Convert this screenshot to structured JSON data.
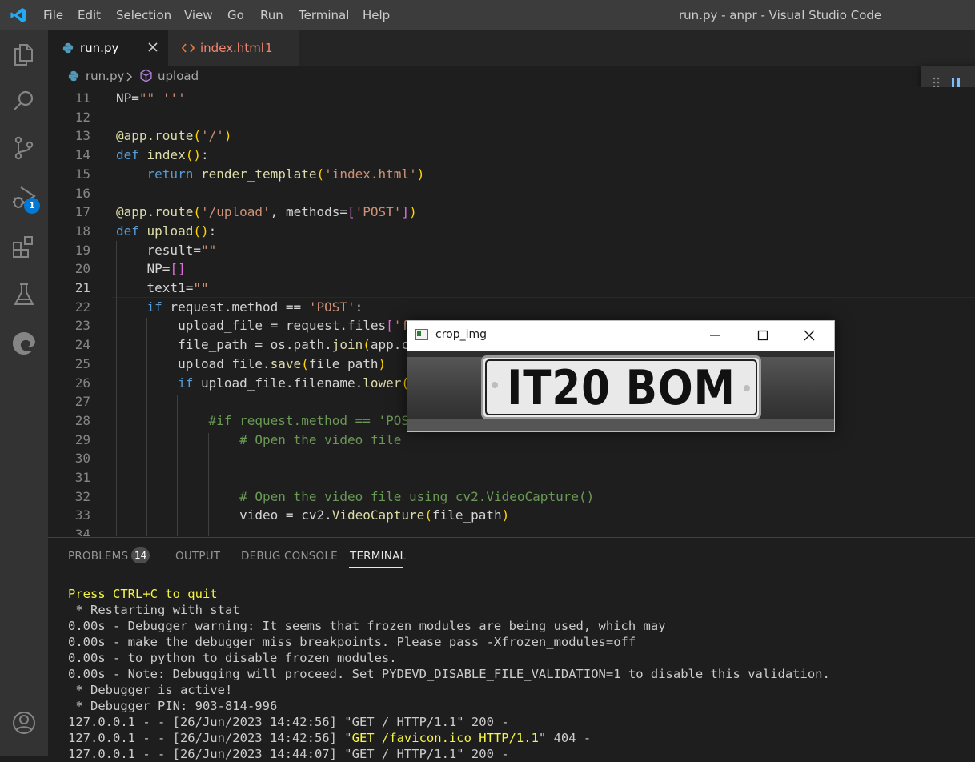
{
  "menubar": {
    "items": [
      "File",
      "Edit",
      "Selection",
      "View",
      "Go",
      "Run",
      "Terminal",
      "Help"
    ],
    "window_title": "run.py - anpr - Visual Studio Code"
  },
  "activity_bar": {
    "icons": [
      "explorer-icon",
      "search-icon",
      "source-control-icon",
      "run-debug-icon",
      "extensions-icon",
      "testing-icon",
      "edge-devtools-icon",
      "account-icon"
    ],
    "debug_badge": "1"
  },
  "tabs": [
    {
      "label": "run.py",
      "active": true
    },
    {
      "label": "index.html",
      "problems": "1",
      "active": false
    }
  ],
  "breadcrumb": {
    "file": "run.py",
    "symbol": "upload"
  },
  "editor": {
    "lines": [
      {
        "n": "11",
        "code": "NP=\"\" '''"
      },
      {
        "n": "12",
        "code": ""
      },
      {
        "n": "13",
        "code": "@app.route('/')"
      },
      {
        "n": "14",
        "code": "def index():"
      },
      {
        "n": "15",
        "code": "    return render_template('index.html')"
      },
      {
        "n": "16",
        "code": ""
      },
      {
        "n": "17",
        "code": "@app.route('/upload', methods=['POST'])"
      },
      {
        "n": "18",
        "code": "def upload():"
      },
      {
        "n": "19",
        "code": "    result=\"\""
      },
      {
        "n": "20",
        "code": "    NP=[]"
      },
      {
        "n": "21",
        "code": "    text1=\"\""
      },
      {
        "n": "22",
        "code": "    if request.method == 'POST':"
      },
      {
        "n": "23",
        "code": "        upload_file = request.files['f"
      },
      {
        "n": "24",
        "code": "        file_path = os.path.join(app.c"
      },
      {
        "n": "25",
        "code": "        upload_file.save(file_path)"
      },
      {
        "n": "26",
        "code": "        if upload_file.filename.lower("
      },
      {
        "n": "27",
        "code": ""
      },
      {
        "n": "28",
        "code": "            #if request.method == 'POS"
      },
      {
        "n": "29",
        "code": "                # Open the video file"
      },
      {
        "n": "30",
        "code": ""
      },
      {
        "n": "31",
        "code": ""
      },
      {
        "n": "32",
        "code": "                # Open the video file using cv2.VideoCapture()"
      },
      {
        "n": "33",
        "code": "                video = cv2.VideoCapture(file_path)"
      },
      {
        "n": "34",
        "code": ""
      }
    ],
    "active_line": "21"
  },
  "panel": {
    "tabs": [
      "PROBLEMS",
      "OUTPUT",
      "DEBUG CONSOLE",
      "TERMINAL"
    ],
    "problems_count": "14",
    "active_tab": "TERMINAL",
    "terminal_lines": [
      "Press CTRL+C to quit",
      " * Restarting with stat",
      "0.00s - Debugger warning: It seems that frozen modules are being used, which may",
      "0.00s - make the debugger miss breakpoints. Please pass -Xfrozen_modules=off",
      "0.00s - to python to disable frozen modules.",
      "0.00s - Note: Debugging will proceed. Set PYDEVD_DISABLE_FILE_VALIDATION=1 to disable this validation.",
      " * Debugger is active!",
      " * Debugger PIN: 903-814-996",
      "127.0.0.1 - - [26/Jun/2023 14:42:56] \"GET / HTTP/1.1\" 200 -",
      "127.0.0.1 - - [26/Jun/2023 14:42:56] \"GET /favicon.ico HTTP/1.1\" 404 -",
      "127.0.0.1 - - [26/Jun/2023 14:44:07] \"GET / HTTP/1.1\" 200 -"
    ]
  },
  "crop_window": {
    "title": "crop_img",
    "plate_text": "IT20 BOM"
  },
  "colors": {
    "accent_blue": "#0078d4",
    "keyword": "#569cd6",
    "string": "#ce9178",
    "comment": "#6a9955",
    "function": "#dcdcaa",
    "terminal_yellow": "#f5f543"
  }
}
